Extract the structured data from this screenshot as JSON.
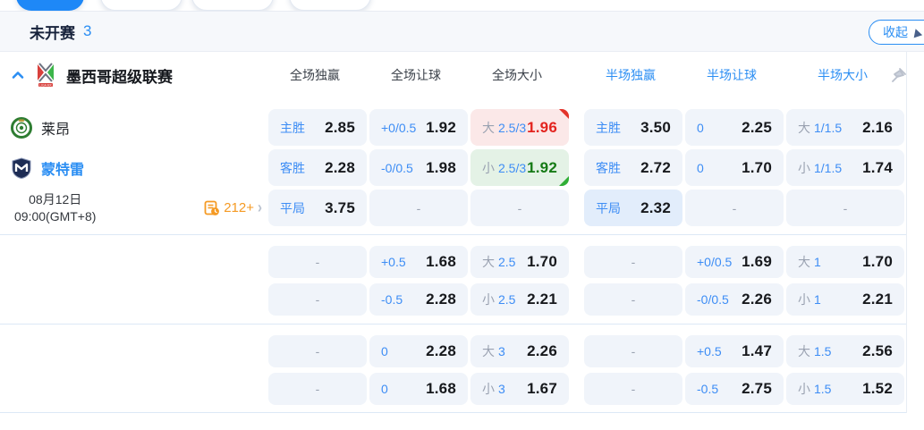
{
  "colors": {
    "accent": "#2b8ef3",
    "odds_up_red": "#e3241f",
    "odds_down_green": "#157a15",
    "cell_bg": "#f0f4fa",
    "cell_up_bg": "#fbe8e8",
    "cell_down_bg": "#e4f2e6",
    "markets_orange": "#f59a23"
  },
  "section": {
    "title": "未开赛",
    "count": "3",
    "collapse_label": "收起"
  },
  "league": {
    "name": "墨西哥超级联赛",
    "logo_text": "LIGA MX"
  },
  "columns": {
    "full_win": "全场独赢",
    "full_handicap": "全场让球",
    "full_ou": "全场大小",
    "half_win": "半场独赢",
    "half_handicap": "半场让球",
    "half_ou": "半场大小"
  },
  "match": {
    "home_team": "莱昂",
    "away_team": "蒙特雷",
    "date": "08月12日",
    "time": "09:00(GMT+8)",
    "markets_count": "212+"
  },
  "grid": {
    "dash": "-",
    "rows": [
      {
        "cells": [
          {
            "b": "主胜",
            "v": "2.85"
          },
          {
            "b": "+0/0.5",
            "v": "1.92"
          },
          {
            "g": "大",
            "b": "2.5/3",
            "v": "1.96",
            "trend": "up"
          },
          {
            "b": "主胜",
            "v": "3.50"
          },
          {
            "b": "0",
            "v": "2.25"
          },
          {
            "g": "大",
            "b": "1/1.5",
            "v": "2.16"
          }
        ]
      },
      {
        "cells": [
          {
            "b": "客胜",
            "v": "2.28"
          },
          {
            "b": "-0/0.5",
            "v": "1.98"
          },
          {
            "g": "小",
            "b": "2.5/3",
            "v": "1.92",
            "trend": "down"
          },
          {
            "b": "客胜",
            "v": "2.72"
          },
          {
            "b": "0",
            "v": "1.70"
          },
          {
            "g": "小",
            "b": "1/1.5",
            "v": "1.74"
          }
        ]
      },
      {
        "cells": [
          {
            "b": "平局",
            "v": "3.75"
          },
          {
            "dash": true
          },
          {
            "dash": true
          },
          {
            "b": "平局",
            "v": "2.32",
            "highlight": true
          },
          {
            "dash": true
          },
          {
            "dash": true
          }
        ]
      },
      {
        "cells": [
          {
            "dash": true
          },
          {
            "b": "+0.5",
            "v": "1.68"
          },
          {
            "g": "大",
            "b": "2.5",
            "v": "1.70"
          },
          {
            "dash": true
          },
          {
            "b": "+0/0.5",
            "v": "1.69"
          },
          {
            "g": "大",
            "b": "1",
            "v": "1.70"
          }
        ]
      },
      {
        "cells": [
          {
            "dash": true
          },
          {
            "b": "-0.5",
            "v": "2.28"
          },
          {
            "g": "小",
            "b": "2.5",
            "v": "2.21"
          },
          {
            "dash": true
          },
          {
            "b": "-0/0.5",
            "v": "2.26"
          },
          {
            "g": "小",
            "b": "1",
            "v": "2.21"
          }
        ]
      },
      {
        "cells": [
          {
            "dash": true
          },
          {
            "b": "0",
            "v": "2.28"
          },
          {
            "g": "大",
            "b": "3",
            "v": "2.26"
          },
          {
            "dash": true
          },
          {
            "b": "+0.5",
            "v": "1.47"
          },
          {
            "g": "大",
            "b": "1.5",
            "v": "2.56"
          }
        ]
      },
      {
        "cells": [
          {
            "dash": true
          },
          {
            "b": "0",
            "v": "1.68"
          },
          {
            "g": "小",
            "b": "3",
            "v": "1.67"
          },
          {
            "dash": true
          },
          {
            "b": "-0.5",
            "v": "2.75"
          },
          {
            "g": "小",
            "b": "1.5",
            "v": "1.52"
          }
        ]
      }
    ]
  }
}
